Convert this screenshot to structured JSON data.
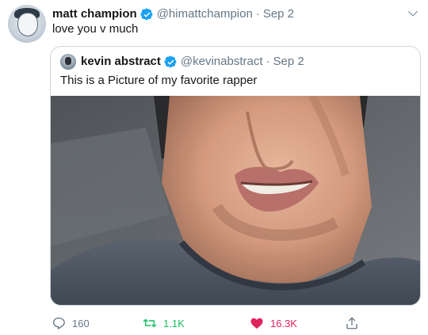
{
  "tweet": {
    "author_name": "matt champion",
    "handle": "@himattchampion",
    "separator": "·",
    "date": "Sep 2",
    "text": "love you v much"
  },
  "quoted": {
    "author_name": "kevin abstract",
    "handle": "@kevinabstract",
    "separator": "·",
    "date": "Sep 2",
    "text": "This is a Picture of my favorite rapper"
  },
  "actions": {
    "reply_count": "160",
    "retweet_count": "1.1K",
    "like_count": "16.3K"
  },
  "colors": {
    "verified": "#1da1f2",
    "like": "#e0245e",
    "muted": "#657786",
    "border": "#ccd6dd"
  },
  "icons": {
    "verified": "verified-badge-icon",
    "menu": "chevron-down-icon",
    "reply": "reply-icon",
    "retweet": "retweet-icon",
    "like": "heart-icon",
    "share": "share-icon"
  }
}
